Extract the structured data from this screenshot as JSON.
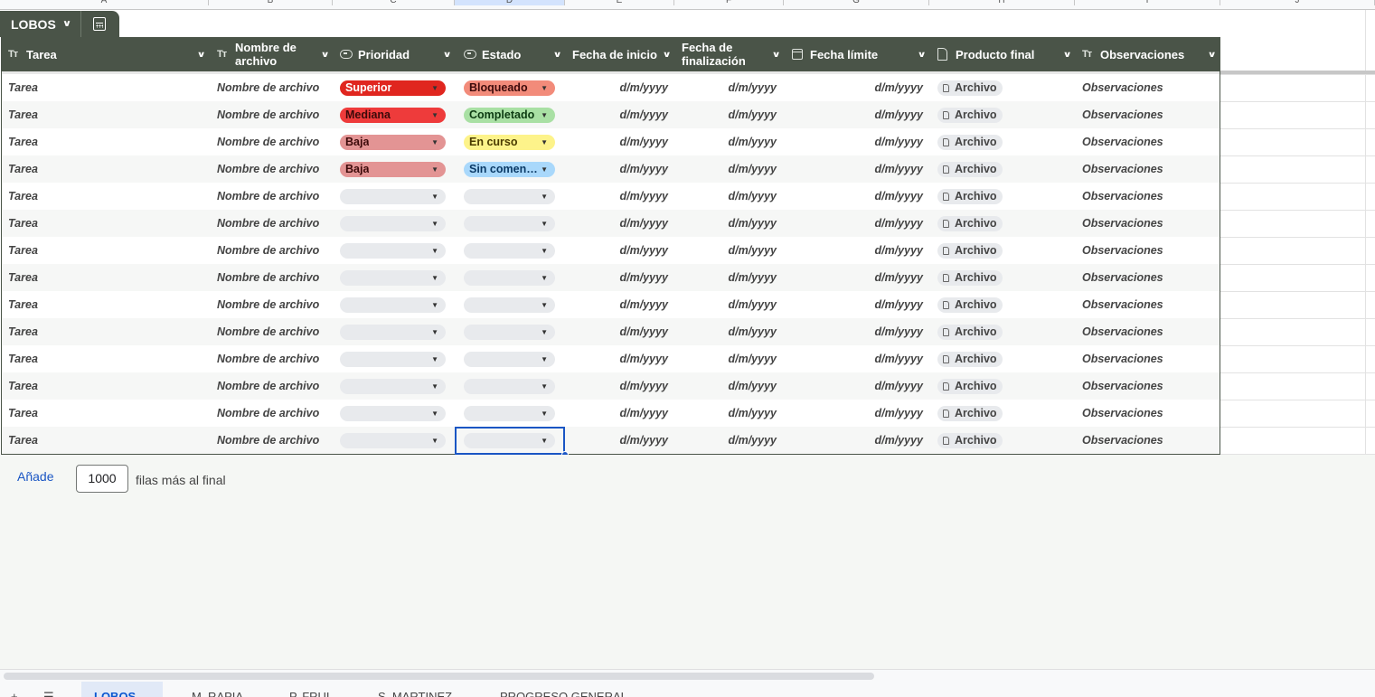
{
  "sheet_columns": [
    "A",
    "B",
    "C",
    "D",
    "E",
    "F",
    "G",
    "H",
    "I",
    "J"
  ],
  "table": {
    "name": "LOBOS",
    "columns": [
      {
        "label": "Tarea",
        "icon": "text-type-icon"
      },
      {
        "label": "Nombre de archivo",
        "icon": "text-type-icon"
      },
      {
        "label": "Prioridad",
        "icon": "dropdown-chip-icon"
      },
      {
        "label": "Estado",
        "icon": "dropdown-chip-icon"
      },
      {
        "label": "Fecha de inicio",
        "icon": ""
      },
      {
        "label": "Fecha de finalización",
        "icon": ""
      },
      {
        "label": "Fecha límite",
        "icon": "calendar-icon"
      },
      {
        "label": "Producto final",
        "icon": "file-icon"
      },
      {
        "label": "Observaciones",
        "icon": "text-type-icon"
      }
    ],
    "rows": [
      {
        "tarea": "Tarea",
        "archivo": "Nombre de archivo",
        "prioridad": "Superior",
        "estado": "Bloqueado",
        "inicio": "d/m/yyyy",
        "fin": "d/m/yyyy",
        "limite": "d/m/yyyy",
        "producto": "Archivo",
        "obs": "Observaciones"
      },
      {
        "tarea": "Tarea",
        "archivo": "Nombre de archivo",
        "prioridad": "Mediana",
        "estado": "Completado",
        "inicio": "d/m/yyyy",
        "fin": "d/m/yyyy",
        "limite": "d/m/yyyy",
        "producto": "Archivo",
        "obs": "Observaciones"
      },
      {
        "tarea": "Tarea",
        "archivo": "Nombre de archivo",
        "prioridad": "Baja",
        "estado": "En curso",
        "inicio": "d/m/yyyy",
        "fin": "d/m/yyyy",
        "limite": "d/m/yyyy",
        "producto": "Archivo",
        "obs": "Observaciones"
      },
      {
        "tarea": "Tarea",
        "archivo": "Nombre de archivo",
        "prioridad": "Baja",
        "estado": "Sin comen…",
        "inicio": "d/m/yyyy",
        "fin": "d/m/yyyy",
        "limite": "d/m/yyyy",
        "producto": "Archivo",
        "obs": "Observaciones"
      },
      {
        "tarea": "Tarea",
        "archivo": "Nombre de archivo",
        "prioridad": "",
        "estado": "",
        "inicio": "d/m/yyyy",
        "fin": "d/m/yyyy",
        "limite": "d/m/yyyy",
        "producto": "Archivo",
        "obs": "Observaciones"
      },
      {
        "tarea": "Tarea",
        "archivo": "Nombre de archivo",
        "prioridad": "",
        "estado": "",
        "inicio": "d/m/yyyy",
        "fin": "d/m/yyyy",
        "limite": "d/m/yyyy",
        "producto": "Archivo",
        "obs": "Observaciones"
      },
      {
        "tarea": "Tarea",
        "archivo": "Nombre de archivo",
        "prioridad": "",
        "estado": "",
        "inicio": "d/m/yyyy",
        "fin": "d/m/yyyy",
        "limite": "d/m/yyyy",
        "producto": "Archivo",
        "obs": "Observaciones"
      },
      {
        "tarea": "Tarea",
        "archivo": "Nombre de archivo",
        "prioridad": "",
        "estado": "",
        "inicio": "d/m/yyyy",
        "fin": "d/m/yyyy",
        "limite": "d/m/yyyy",
        "producto": "Archivo",
        "obs": "Observaciones"
      },
      {
        "tarea": "Tarea",
        "archivo": "Nombre de archivo",
        "prioridad": "",
        "estado": "",
        "inicio": "d/m/yyyy",
        "fin": "d/m/yyyy",
        "limite": "d/m/yyyy",
        "producto": "Archivo",
        "obs": "Observaciones"
      },
      {
        "tarea": "Tarea",
        "archivo": "Nombre de archivo",
        "prioridad": "",
        "estado": "",
        "inicio": "d/m/yyyy",
        "fin": "d/m/yyyy",
        "limite": "d/m/yyyy",
        "producto": "Archivo",
        "obs": "Observaciones"
      },
      {
        "tarea": "Tarea",
        "archivo": "Nombre de archivo",
        "prioridad": "",
        "estado": "",
        "inicio": "d/m/yyyy",
        "fin": "d/m/yyyy",
        "limite": "d/m/yyyy",
        "producto": "Archivo",
        "obs": "Observaciones"
      },
      {
        "tarea": "Tarea",
        "archivo": "Nombre de archivo",
        "prioridad": "",
        "estado": "",
        "inicio": "d/m/yyyy",
        "fin": "d/m/yyyy",
        "limite": "d/m/yyyy",
        "producto": "Archivo",
        "obs": "Observaciones"
      },
      {
        "tarea": "Tarea",
        "archivo": "Nombre de archivo",
        "prioridad": "",
        "estado": "",
        "inicio": "d/m/yyyy",
        "fin": "d/m/yyyy",
        "limite": "d/m/yyyy",
        "producto": "Archivo",
        "obs": "Observaciones"
      },
      {
        "tarea": "Tarea",
        "archivo": "Nombre de archivo",
        "prioridad": "",
        "estado": "",
        "inicio": "d/m/yyyy",
        "fin": "d/m/yyyy",
        "limite": "d/m/yyyy",
        "producto": "Archivo",
        "obs": "Observaciones"
      }
    ]
  },
  "chip_colors": {
    "Superior": {
      "bg": "#e0261f",
      "fg": "#ffffff"
    },
    "Mediana": {
      "bg": "#ee3b3b",
      "fg": "#3c0a0a"
    },
    "Baja": {
      "bg": "#e39494",
      "fg": "#3c0a0a"
    },
    "Bloqueado": {
      "bg": "#f28b7a",
      "fg": "#3c0a0a"
    },
    "Completado": {
      "bg": "#a9e0a4",
      "fg": "#0d3b12"
    },
    "En curso": {
      "bg": "#fdf38a",
      "fg": "#4a3b00"
    },
    "Sin comen…": {
      "bg": "#a9d8fb",
      "fg": "#0b3a66"
    }
  },
  "add_rows": {
    "link": "Añade",
    "count": "1000",
    "suffix": "filas más al final"
  },
  "sheet_tabs": [
    "LOBOS",
    "M. RAPIA",
    "P. FRUI",
    "S. MARTINEZ",
    "PROGRESO GENERAL"
  ],
  "colors": {
    "header_bg": "#4a5448",
    "accent": "#1a56c4"
  }
}
